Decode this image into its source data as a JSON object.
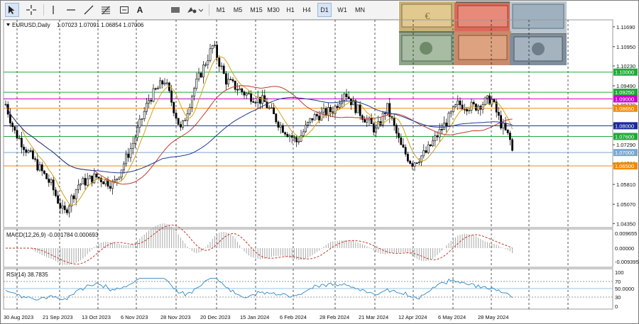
{
  "toolbar": {
    "tools": [
      {
        "name": "cursor-tool",
        "icon": "arrow-cursor-icon"
      },
      {
        "name": "crosshair-tool",
        "icon": "crosshair-icon"
      },
      {
        "name": "vertical-line-tool",
        "icon": "vertical-line-icon"
      },
      {
        "name": "horizontal-line-tool",
        "icon": "horizontal-line-icon"
      },
      {
        "name": "trendline-tool",
        "icon": "trendline-icon"
      },
      {
        "name": "fibonacci-tool",
        "icon": "fibonacci-icon"
      },
      {
        "name": "text-tool",
        "label": "A"
      },
      {
        "name": "label-tool",
        "icon": "text-label-icon"
      },
      {
        "name": "shapes-tool",
        "icon": "shapes-icon"
      }
    ],
    "timeframes": [
      "M1",
      "M5",
      "M15",
      "M30",
      "H1",
      "H4",
      "D1",
      "W1",
      "MN"
    ],
    "active_timeframe": "D1"
  },
  "chart_header": {
    "symbol": "EURUSD,Daily",
    "ohlc": "1.07023 1.07091 1.06854 1.07006"
  },
  "price_axis": {
    "ticks": [
      "1.11690",
      "1.10950",
      "1.10230",
      "1.09490",
      "1.08770",
      "1.08040",
      "1.07290",
      "1.06590",
      "1.05810",
      "1.05070",
      "1.04350"
    ],
    "levels": [
      {
        "label": "1.10000",
        "value": 1.1,
        "color": "#22a83a"
      },
      {
        "label": "1.09250",
        "value": 1.0925,
        "color": "#22a83a"
      },
      {
        "label": "1.09000",
        "value": 1.09,
        "color": "#cc00cc"
      },
      {
        "label": "1.08650",
        "value": 1.0865,
        "color": "#f08a00"
      },
      {
        "label": "1.08000",
        "value": 1.08,
        "color": "#1a2a9c"
      },
      {
        "label": "1.07600",
        "value": 1.076,
        "color": "#22a83a"
      },
      {
        "label": "1.07000",
        "value": 1.07,
        "color": "#7ba7cf"
      },
      {
        "label": "1.06500",
        "value": 1.065,
        "color": "#f08a00"
      }
    ],
    "level_line_color": {
      "1.10000": "#22a83a",
      "1.09000": "#cc00cc",
      "1.08650": "#f08a00",
      "1.08000": "#1a2a9c",
      "1.07600": "#22a83a",
      "1.07000": "#7ba7cf",
      "1.06500": "#f08a00"
    }
  },
  "macd": {
    "label": "MACD(12,26,9) -0.001784 0.000693",
    "ticks": [
      "0.009655",
      "0.00000",
      "-0.009395"
    ]
  },
  "rsi": {
    "label": "RSI(14) 38.7835",
    "ticks": [
      "100",
      "70",
      "50.0000",
      "30",
      "0"
    ]
  },
  "time_axis": [
    "30 Aug 2023",
    "21 Sep 2023",
    "13 Oct 2023",
    "6 Nov 2023",
    "28 Nov 2023",
    "20 Dec 2023",
    "15 Jan 2024",
    "6 Feb 2024",
    "28 Feb 2024",
    "21 Mar 2024",
    "12 Apr 2024",
    "6 May 2024",
    "28 May 2024"
  ],
  "colors": {
    "bull": "#000000",
    "bear": "#000000",
    "ma_fast": "#d4a017",
    "ma_mid": "#c0392b",
    "ma_slow": "#1f3a93",
    "macd_hist": "#a8a8a8",
    "macd_signal": "#c0392b",
    "rsi_line": "#2e86c1"
  },
  "photo": {
    "description_icon": "currency-banknotes-image"
  }
}
